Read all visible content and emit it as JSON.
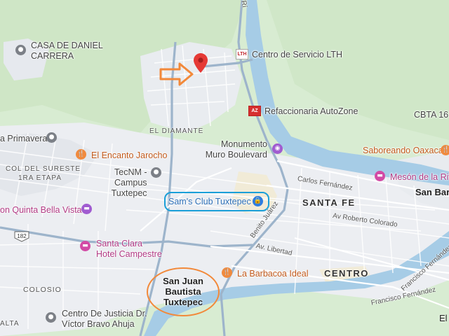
{
  "map": {
    "places": {
      "casa_daniel_line1": "CASA DE DANIEL",
      "casa_daniel_line2": "CARRERA",
      "centro_servicio": "Centro de Servicio LTH",
      "refaccionaria": "Refaccionaria AutoZone",
      "cbta": "CBTA 16",
      "primavera": "a Primavera",
      "el_diamante": "EL DIAMANTE",
      "monumento_line1": "Monumento",
      "monumento_line2": "Muro Boulevard",
      "saboreando": "Saboreando Oaxaca",
      "encanto": "El Encanto Jarocho",
      "col_sureste_line1": "COL DEL SURESTE",
      "col_sureste_line2": "1RA ETAPA",
      "tecnm_line1": "TecNM -",
      "tecnm_line2": "Campus",
      "tecnm_line3": "Tuxtepec",
      "meson": "Mesón de la Riv",
      "san_bar": "San Bar",
      "sams": "Sam's Club Tuxtepec",
      "santa_fe": "SANTA FE",
      "quinta": "on Quinta Bella Vista",
      "santa_clara_line1": "Santa Clara",
      "santa_clara_line2": "Hotel Campestre",
      "barbacoa": "La Barbacoa Ideal",
      "centro": "CENTRO",
      "city_line1": "San Juan",
      "city_line2": "Bautista",
      "city_line3": "Tuxtepec",
      "colosio": "COLOSIO",
      "centro_justicia_line1": "Centro De Justicia Dr.",
      "centro_justicia_line2": "Víctor Bravo Ahuja",
      "alta": "ALTA",
      "el_right": "El"
    },
    "streets": {
      "carlos_fernandez": "Carlos Fernández",
      "av_roberto": "Av Roberto Colorado",
      "benito": "Benito Juárez",
      "av_libertad": "Av. Libertad",
      "francisco_1": "Francisco Fernández",
      "francisco_2": "Francisco Fernández",
      "river_top": "Rí",
      "highway_shield": "182"
    },
    "icons": {
      "pin": "red-location-pin",
      "annotation_arrow": "orange-arrow",
      "grey_marker": "landmark-icon",
      "restaurant": "fork-knife-icon",
      "lodging": "bed-icon",
      "monument": "camera-icon",
      "shopping": "shopping-bag-icon",
      "lth_logo": "lth-logo",
      "autozone_logo": "autozone-logo"
    },
    "colors": {
      "land": "#d8ecd2",
      "urban": "#eef0f3",
      "water": "#a6cce6",
      "road_major": "#8fa9c2",
      "pin": "#e53935",
      "annotation_orange": "#f2893a",
      "annotation_blue": "#1a9fd8"
    }
  }
}
